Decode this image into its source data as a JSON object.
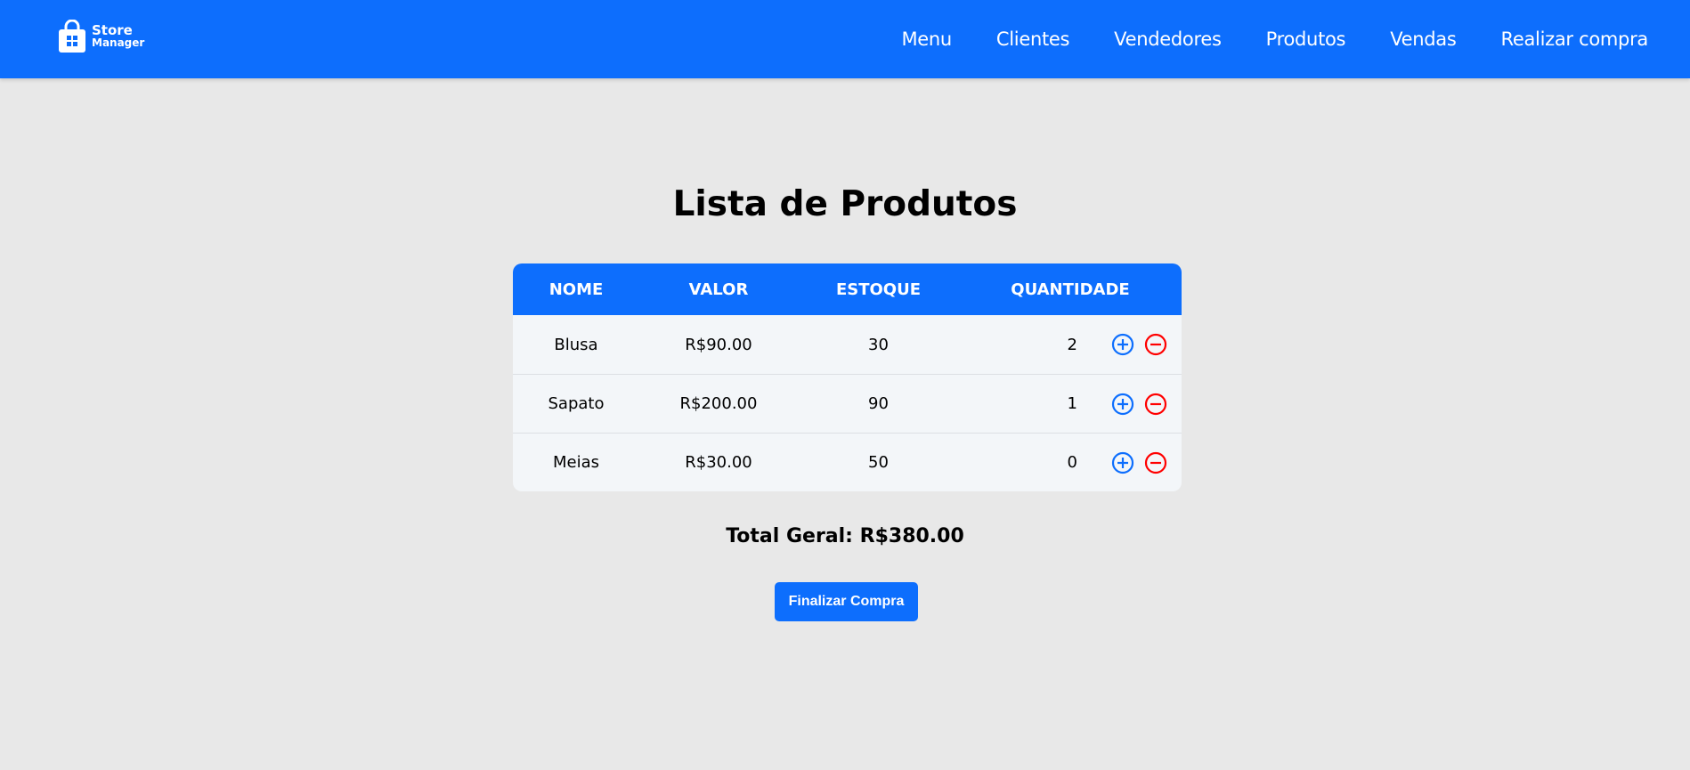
{
  "nav": {
    "logo": {
      "line1": "Store",
      "line2": "Manager"
    },
    "items": [
      "Menu",
      "Clientes",
      "Vendedores",
      "Produtos",
      "Vendas",
      "Realizar compra"
    ]
  },
  "page_title": "Lista de Produtos",
  "table": {
    "headers": [
      "NOME",
      "VALOR",
      "ESTOQUE",
      "QUANTIDADE"
    ],
    "rows": [
      {
        "nome": "Blusa",
        "valor": "R$90.00",
        "estoque": "30",
        "quantidade": "2"
      },
      {
        "nome": "Sapato",
        "valor": "R$200.00",
        "estoque": "90",
        "quantidade": "1"
      },
      {
        "nome": "Meias",
        "valor": "R$30.00",
        "estoque": "50",
        "quantidade": "0"
      }
    ]
  },
  "total": "Total Geral: R$380.00",
  "finish_button": "Finalizar Compra",
  "colors": {
    "primary": "#0d6efd",
    "danger": "#ff0000",
    "background": "#e8e8e8"
  }
}
